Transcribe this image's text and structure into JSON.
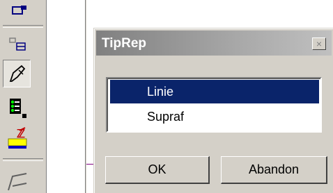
{
  "dialog": {
    "title": "TipRep",
    "close_label": "×",
    "list_items": [
      {
        "label": "Linie",
        "selected": true
      },
      {
        "label": "Supraf",
        "selected": false
      }
    ],
    "ok_label": "OK",
    "cancel_label": "Abandon"
  },
  "toolbar": {
    "icons": [
      "grid-tool-icon",
      "align-tool-icon",
      "brush-tool-icon",
      "list-tool-icon",
      "edit-layer-icon",
      "shape-tool-icon"
    ]
  },
  "colors": {
    "selection": "#0a246a",
    "face": "#d4d0c8",
    "titlebar_start": "#808080",
    "titlebar_end": "#c0c0c0"
  }
}
